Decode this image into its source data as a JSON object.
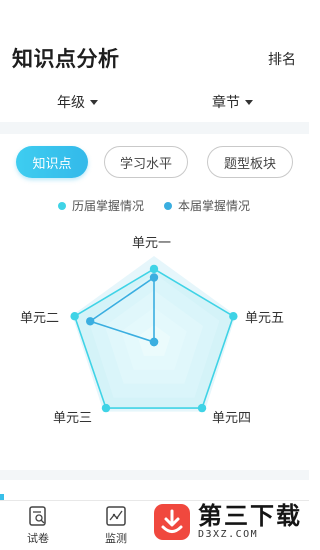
{
  "header": {
    "title": "知识点分析",
    "rank_label": "排名"
  },
  "filters": {
    "grade": "年级",
    "chapter": "章节"
  },
  "tabs": [
    {
      "label": "知识点",
      "active": true
    },
    {
      "label": "学习水平",
      "active": false
    },
    {
      "label": "题型板块",
      "active": false
    }
  ],
  "legend": [
    {
      "label": "历届掌握情况",
      "color": "#3fd3e6"
    },
    {
      "label": "本届掌握情况",
      "color": "#3aaee0"
    }
  ],
  "chart_data": {
    "type": "radar",
    "axes": [
      "单元一",
      "单元五",
      "单元四",
      "单元三",
      "单元二"
    ],
    "ylim": [
      0,
      1
    ],
    "series": [
      {
        "name": "历届掌握情况",
        "values": [
          0.85,
          0.97,
          0.95,
          0.95,
          0.97
        ],
        "color": "#3fd3e6"
      },
      {
        "name": "本届掌握情况",
        "values": [
          0.75,
          0.0,
          0.0,
          0.0,
          0.78
        ],
        "color": "#3aaee0"
      }
    ]
  },
  "bottom_nav": [
    {
      "label": "试卷",
      "icon": "exam-paper-icon"
    },
    {
      "label": "监测",
      "icon": "monitor-chart-icon"
    }
  ],
  "watermark": {
    "title": "第三下载",
    "subtitle": "D3XZ.COM"
  },
  "colors": {
    "accent": "#38bfe9",
    "tab_gradient_start": "#3ecdf0",
    "tab_gradient_end": "#33b9ea"
  }
}
